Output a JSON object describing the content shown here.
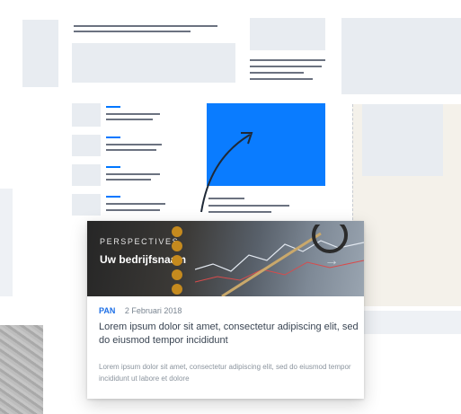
{
  "card": {
    "kicker": "PERSPECTIVES",
    "headline": "Uw bedrijfsnaam",
    "tag": "PAN",
    "date": "2 Februari 2018",
    "title": "Lorem ipsum dolor sit amet, consectetur adipiscing elit, sed do eiusmod tempor incididunt",
    "excerpt": "Lorem ipsum dolor sit amet, consectetur adipiscing elit, sed do eiusmod tempor incididunt ut labore et dolore"
  },
  "icons": {
    "arrow": "curved-arrow-icon",
    "next": "arrow-right-icon"
  },
  "colors": {
    "accent": "#0a7cff",
    "tag": "#1d6fe6"
  }
}
